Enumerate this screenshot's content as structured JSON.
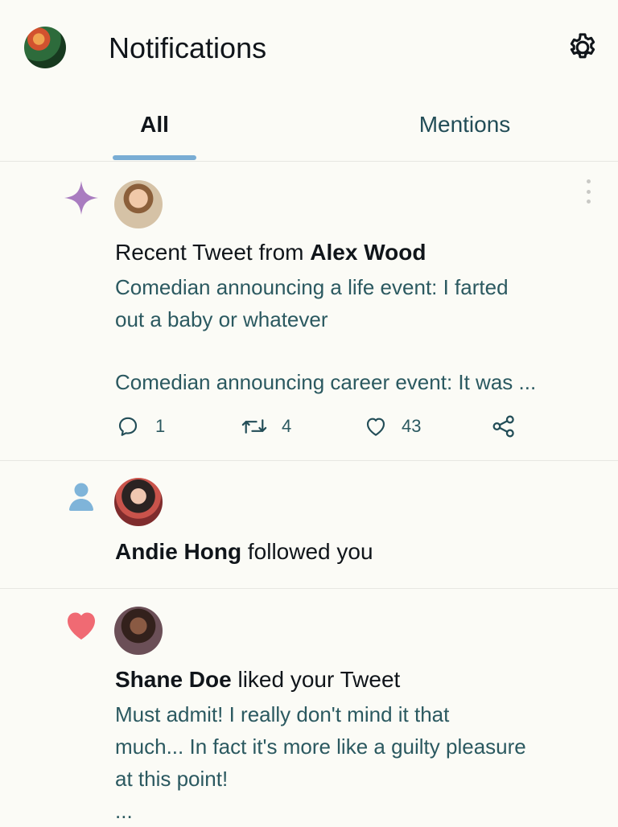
{
  "header": {
    "title": "Notifications"
  },
  "tabs": [
    {
      "label": "All",
      "selected": true
    },
    {
      "label": "Mentions",
      "selected": false
    }
  ],
  "notifications": [
    {
      "type_icon": "sparkle-icon",
      "headline_prefix": "Recent Tweet from ",
      "name": "Alex Wood",
      "body_lines": [
        "Comedian announcing a life event: I farted",
        "out a baby or whatever",
        "",
        "Comedian announcing career event: It was ..."
      ],
      "actions": {
        "reply_count": "1",
        "retweet_count": "4",
        "like_count": "43"
      }
    },
    {
      "type_icon": "person-icon",
      "name": "Andie Hong",
      "headline_suffix": " followed you"
    },
    {
      "type_icon": "heart-icon",
      "name": "Shane Doe",
      "headline_suffix": " liked your Tweet",
      "body_lines": [
        "Must admit! I really don't mind it that",
        "much... In fact it's more like a guilty pleasure",
        "at this point!",
        "..."
      ]
    }
  ],
  "colors": {
    "accent": "#79add4",
    "sparkle": "#a97cc0",
    "heart": "#f06a73",
    "follow": "#7fb4d9",
    "muted_text": "#2b5960"
  }
}
